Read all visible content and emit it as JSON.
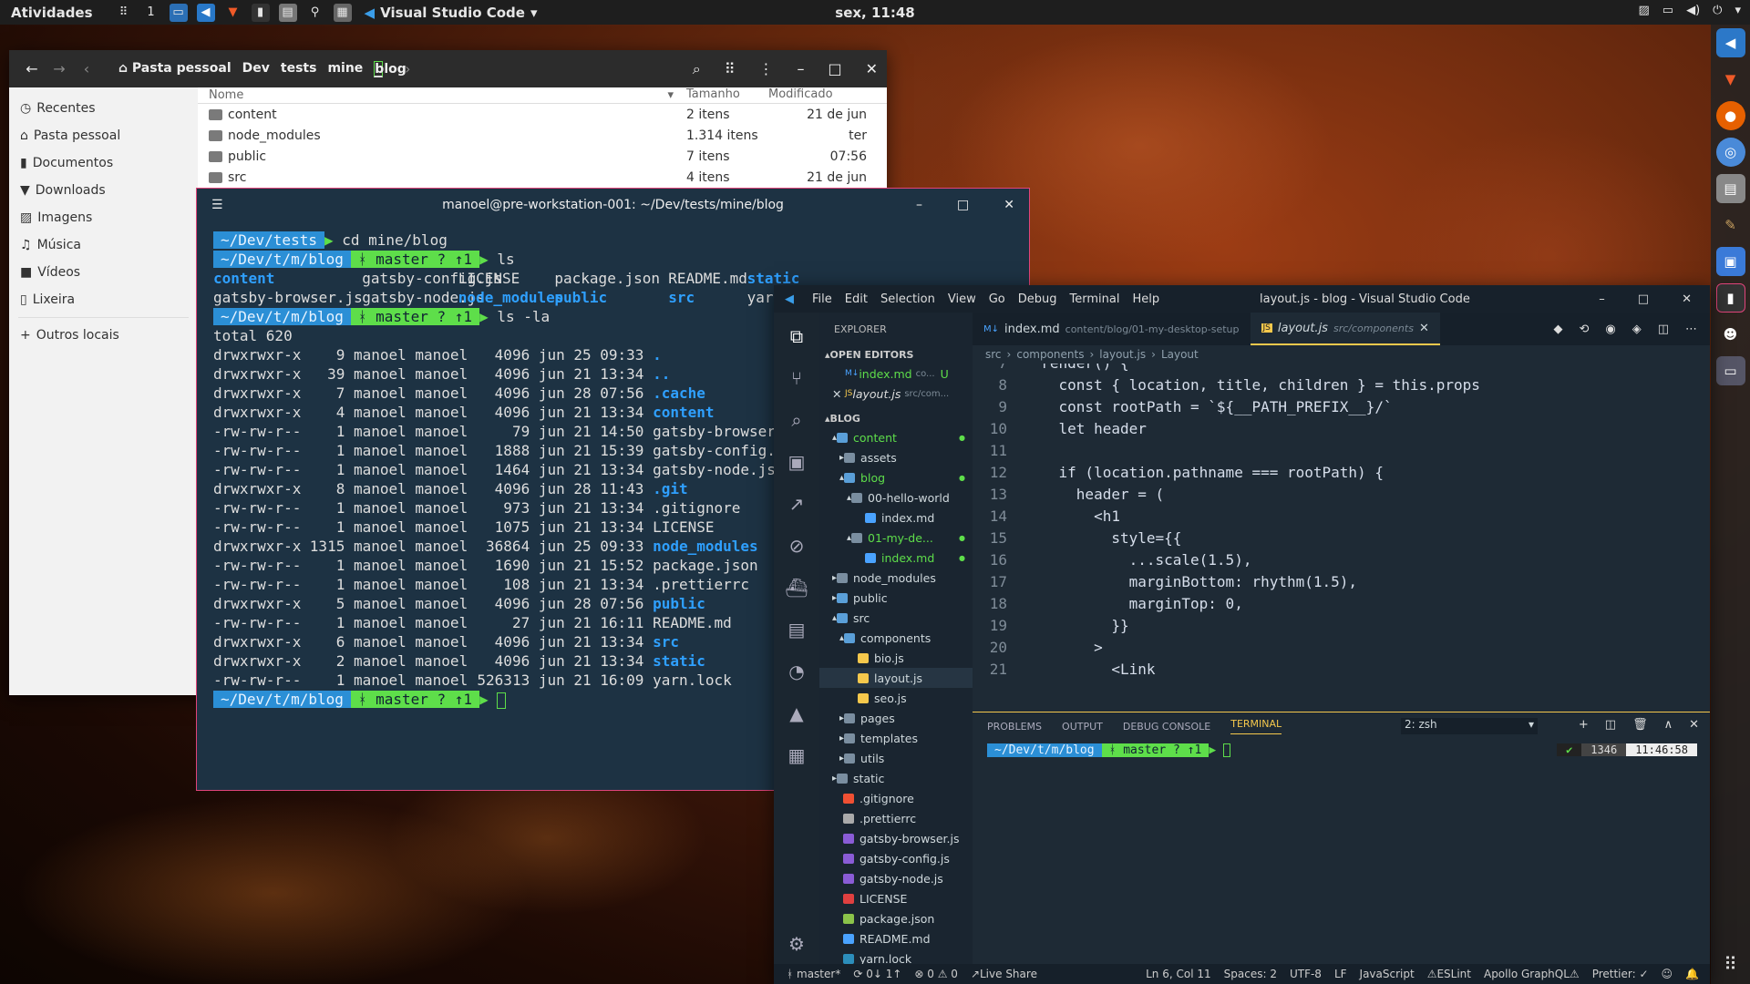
{
  "topbar": {
    "activities": "Atividades",
    "workspace": "1",
    "app_name": "Visual Studio Code",
    "clock": "sex, 11:48"
  },
  "file_manager": {
    "breadcrumb": [
      "Pasta pessoal",
      "Dev",
      "tests",
      "mine",
      "blog"
    ],
    "sidebar": [
      {
        "icon": "clock-icon",
        "label": "Recentes"
      },
      {
        "icon": "home-icon",
        "label": "Pasta pessoal"
      },
      {
        "icon": "document-icon",
        "label": "Documentos"
      },
      {
        "icon": "download-icon",
        "label": "Downloads"
      },
      {
        "icon": "image-icon",
        "label": "Imagens"
      },
      {
        "icon": "music-icon",
        "label": "Música"
      },
      {
        "icon": "video-icon",
        "label": "Vídeos"
      },
      {
        "icon": "trash-icon",
        "label": "Lixeira"
      },
      {
        "icon": "plus-icon",
        "label": "Outros locais"
      }
    ],
    "columns": {
      "name": "Nome",
      "size": "Tamanho",
      "modified": "Modificado"
    },
    "rows": [
      {
        "name": "content",
        "size": "2 itens",
        "mod": "21 de jun"
      },
      {
        "name": "node_modules",
        "size": "1.314 itens",
        "mod": "ter"
      },
      {
        "name": "public",
        "size": "7 itens",
        "mod": "07:56"
      },
      {
        "name": "src",
        "size": "4 itens",
        "mod": "21 de jun"
      }
    ]
  },
  "terminal": {
    "title": "manoel@pre-workstation-001: ~/Dev/tests/mine/blog",
    "p1": "~/Dev/tests",
    "c1": "cd mine/blog",
    "p2": "~/Dev/t/m/blog",
    "git": "ᚼ master ? ↑1",
    "c2": "ls",
    "ls1": [
      "content",
      "gatsby-config.js",
      "LICENSE",
      "package.json",
      "README.md",
      "static"
    ],
    "ls2": [
      "gatsby-browser.js",
      "gatsby-node.js",
      "node_modules",
      "public",
      "src",
      "yarn.lock"
    ],
    "c3": "ls -la",
    "total": "total 620",
    "lsla": [
      [
        "drwxrwxr-x",
        "9",
        "4096",
        "jun 25 09:33",
        ".",
        true
      ],
      [
        "drwxrwxr-x",
        "39",
        "4096",
        "jun 21 13:34",
        "..",
        true
      ],
      [
        "drwxrwxr-x",
        "7",
        "4096",
        "jun 28 07:56",
        ".cache",
        true
      ],
      [
        "drwxrwxr-x",
        "4",
        "4096",
        "jun 21 13:34",
        "content",
        true
      ],
      [
        "-rw-rw-r--",
        "1",
        "79",
        "jun 21 14:50",
        "gatsby-browser.js",
        false
      ],
      [
        "-rw-rw-r--",
        "1",
        "1888",
        "jun 21 15:39",
        "gatsby-config.js",
        false
      ],
      [
        "-rw-rw-r--",
        "1",
        "1464",
        "jun 21 13:34",
        "gatsby-node.js",
        false
      ],
      [
        "drwxrwxr-x",
        "8",
        "4096",
        "jun 28 11:43",
        ".git",
        true
      ],
      [
        "-rw-rw-r--",
        "1",
        "973",
        "jun 21 13:34",
        ".gitignore",
        false
      ],
      [
        "-rw-rw-r--",
        "1",
        "1075",
        "jun 21 13:34",
        "LICENSE",
        false
      ],
      [
        "drwxrwxr-x",
        "1315",
        "36864",
        "jun 25 09:33",
        "node_modules",
        true
      ],
      [
        "-rw-rw-r--",
        "1",
        "1690",
        "jun 21 15:52",
        "package.json",
        false
      ],
      [
        "-rw-rw-r--",
        "1",
        "108",
        "jun 21 13:34",
        ".prettierrc",
        false
      ],
      [
        "drwxrwxr-x",
        "5",
        "4096",
        "jun 28 07:56",
        "public",
        true
      ],
      [
        "-rw-rw-r--",
        "1",
        "27",
        "jun 21 16:11",
        "README.md",
        false
      ],
      [
        "drwxrwxr-x",
        "6",
        "4096",
        "jun 21 13:34",
        "src",
        true
      ],
      [
        "drwxrwxr-x",
        "2",
        "4096",
        "jun 21 13:34",
        "static",
        true
      ],
      [
        "-rw-rw-r--",
        "1",
        "526313",
        "jun 21 16:09",
        "yarn.lock",
        false
      ]
    ],
    "user": "manoel manoel"
  },
  "vscode": {
    "menu": [
      "File",
      "Edit",
      "Selection",
      "View",
      "Go",
      "Debug",
      "Terminal",
      "Help"
    ],
    "title": "layout.js - blog - Visual Studio Code",
    "explorer_label": "EXPLORER",
    "open_editors": "OPEN EDITORS",
    "project": "BLOG",
    "open_files": [
      {
        "name": "index.md",
        "sub": "co...",
        "flag": "U"
      },
      {
        "name": "layout.js",
        "sub": "src/com...",
        "flag": ""
      }
    ],
    "tree": [
      {
        "d": 1,
        "name": "content",
        "type": "folder",
        "color": "#5ede4a",
        "open": true
      },
      {
        "d": 2,
        "name": "assets",
        "type": "folder",
        "color": "#aaa",
        "open": false
      },
      {
        "d": 2,
        "name": "blog",
        "type": "folder",
        "color": "#5ede4a",
        "open": true
      },
      {
        "d": 3,
        "name": "00-hello-world",
        "type": "folder",
        "color": "#aaa",
        "open": true
      },
      {
        "d": 4,
        "name": "index.md",
        "type": "md",
        "color": "#aaa",
        "open": false
      },
      {
        "d": 3,
        "name": "01-my-de...",
        "type": "folder",
        "color": "#5ede4a",
        "open": true
      },
      {
        "d": 4,
        "name": "index.md",
        "type": "md",
        "color": "#5ede4a",
        "open": false
      },
      {
        "d": 1,
        "name": "node_modules",
        "type": "folder",
        "color": "#aaa",
        "open": false
      },
      {
        "d": 1,
        "name": "public",
        "type": "folder",
        "color": "#aaa",
        "open": false
      },
      {
        "d": 1,
        "name": "src",
        "type": "folder",
        "color": "#aaa",
        "open": true
      },
      {
        "d": 2,
        "name": "components",
        "type": "folder",
        "color": "#aaa",
        "open": true
      },
      {
        "d": 3,
        "name": "bio.js",
        "type": "js",
        "color": "#aaa",
        "open": false
      },
      {
        "d": 3,
        "name": "layout.js",
        "type": "js",
        "color": "#aaa",
        "open": false
      },
      {
        "d": 3,
        "name": "seo.js",
        "type": "js",
        "color": "#aaa",
        "open": false
      },
      {
        "d": 2,
        "name": "pages",
        "type": "folder",
        "color": "#aaa",
        "open": false
      },
      {
        "d": 2,
        "name": "templates",
        "type": "folder",
        "color": "#aaa",
        "open": false
      },
      {
        "d": 2,
        "name": "utils",
        "type": "folder",
        "color": "#aaa",
        "open": false
      },
      {
        "d": 1,
        "name": "static",
        "type": "folder",
        "color": "#aaa",
        "open": false
      },
      {
        "d": 1,
        "name": ".gitignore",
        "type": "git",
        "color": "#aaa",
        "open": false
      },
      {
        "d": 1,
        "name": ".prettierrc",
        "type": "file",
        "color": "#aaa",
        "open": false
      },
      {
        "d": 1,
        "name": "gatsby-browser.js",
        "type": "gatsby",
        "color": "#aaa",
        "open": false
      },
      {
        "d": 1,
        "name": "gatsby-config.js",
        "type": "gatsby",
        "color": "#aaa",
        "open": false
      },
      {
        "d": 1,
        "name": "gatsby-node.js",
        "type": "gatsby",
        "color": "#aaa",
        "open": false
      },
      {
        "d": 1,
        "name": "LICENSE",
        "type": "license",
        "color": "#aaa",
        "open": false
      },
      {
        "d": 1,
        "name": "package.json",
        "type": "json",
        "color": "#aaa",
        "open": false
      },
      {
        "d": 1,
        "name": "README.md",
        "type": "info",
        "color": "#aaa",
        "open": false
      },
      {
        "d": 1,
        "name": "yarn.lock",
        "type": "yarn",
        "color": "#aaa",
        "open": false
      }
    ],
    "tabs": [
      {
        "name": "index.md",
        "sub": "content/blog/01-my-desktop-setup"
      },
      {
        "name": "layout.js",
        "sub": "src/components"
      }
    ],
    "breadcrumb": [
      "src",
      "components",
      "layout.js",
      "Layout"
    ],
    "code": [
      [
        "7",
        "  render() {"
      ],
      [
        "8",
        "    const { location, title, children } = this.props"
      ],
      [
        "9",
        "    const rootPath = `${__PATH_PREFIX__}/`"
      ],
      [
        "10",
        "    let header"
      ],
      [
        "11",
        ""
      ],
      [
        "12",
        "    if (location.pathname === rootPath) {"
      ],
      [
        "13",
        "      header = ("
      ],
      [
        "14",
        "        <h1"
      ],
      [
        "15",
        "          style={{"
      ],
      [
        "16",
        "            ...scale(1.5),"
      ],
      [
        "17",
        "            marginBottom: rhythm(1.5),"
      ],
      [
        "18",
        "            marginTop: 0,"
      ],
      [
        "19",
        "          }}"
      ],
      [
        "20",
        "        >"
      ],
      [
        "21",
        "          <Link"
      ]
    ],
    "panel_tabs": [
      "PROBLEMS",
      "OUTPUT",
      "DEBUG CONSOLE",
      "TERMINAL"
    ],
    "panel_select": "2: zsh",
    "panel_prompt": "~/Dev/t/m/blog",
    "panel_git": "ᚼ master ? ↑1",
    "panel_right": {
      "check": "✔",
      "num": "1346",
      "time": "11:46:58"
    },
    "status": {
      "branch": "ᚼ master*",
      "sync": "⟳ 0↓ 1↑",
      "errors": "⊗ 0 ⚠ 0",
      "liveshare": "Live Share",
      "pos": "Ln 6, Col 11",
      "spaces": "Spaces: 2",
      "enc": "UTF-8",
      "eol": "LF",
      "lang": "JavaScript",
      "eslint": "ESLint",
      "apollo": "Apollo GraphQL",
      "prettier": "Prettier: ✓"
    }
  }
}
